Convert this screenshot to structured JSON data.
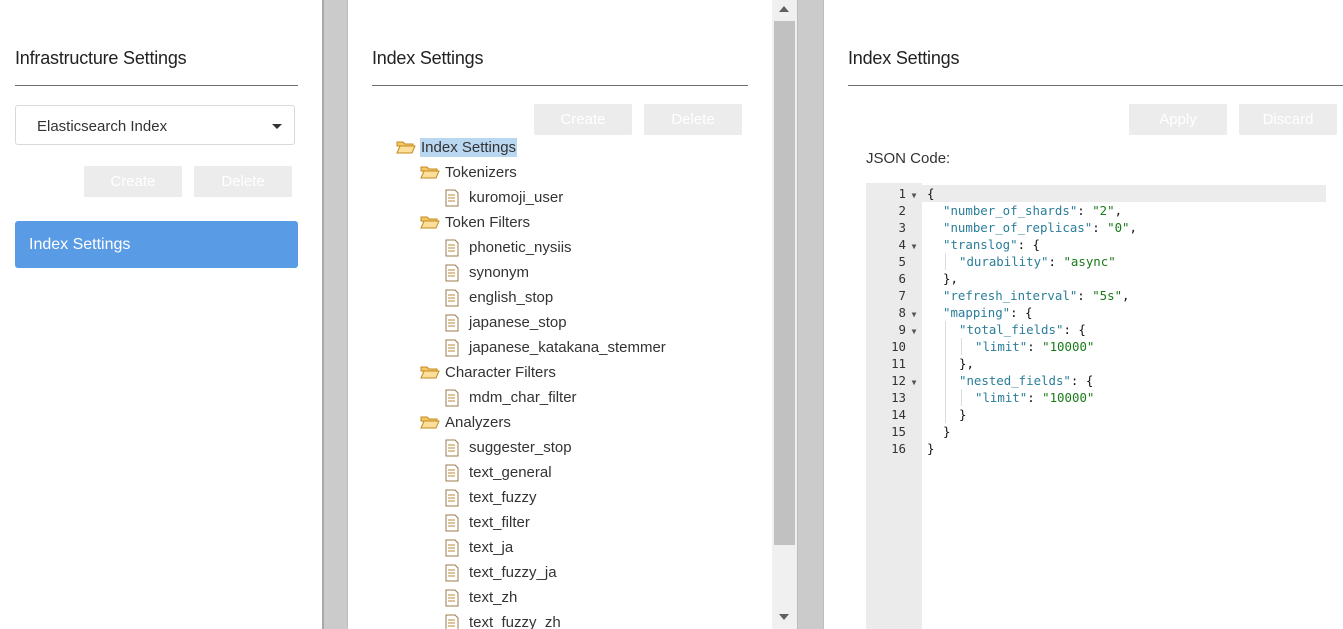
{
  "left_panel": {
    "title": "Infrastructure Settings",
    "dropdown_value": "Elasticsearch Index",
    "create_label": "Create",
    "delete_label": "Delete",
    "nav_items": [
      "Index Settings"
    ]
  },
  "middle_panel": {
    "title": "Index Settings",
    "create_label": "Create",
    "delete_label": "Delete",
    "tree": [
      {
        "label": "Index Settings",
        "type": "folder",
        "level": 0,
        "selected": true
      },
      {
        "label": "Tokenizers",
        "type": "folder",
        "level": 1
      },
      {
        "label": "kuromoji_user",
        "type": "file",
        "level": 2
      },
      {
        "label": "Token Filters",
        "type": "folder",
        "level": 1
      },
      {
        "label": "phonetic_nysiis",
        "type": "file",
        "level": 2
      },
      {
        "label": "synonym",
        "type": "file",
        "level": 2
      },
      {
        "label": "english_stop",
        "type": "file",
        "level": 2
      },
      {
        "label": "japanese_stop",
        "type": "file",
        "level": 2
      },
      {
        "label": "japanese_katakana_stemmer",
        "type": "file",
        "level": 2
      },
      {
        "label": "Character Filters",
        "type": "folder",
        "level": 1
      },
      {
        "label": "mdm_char_filter",
        "type": "file",
        "level": 2
      },
      {
        "label": "Analyzers",
        "type": "folder",
        "level": 1
      },
      {
        "label": "suggester_stop",
        "type": "file",
        "level": 2
      },
      {
        "label": "text_general",
        "type": "file",
        "level": 2
      },
      {
        "label": "text_fuzzy",
        "type": "file",
        "level": 2
      },
      {
        "label": "text_filter",
        "type": "file",
        "level": 2
      },
      {
        "label": "text_ja",
        "type": "file",
        "level": 2
      },
      {
        "label": "text_fuzzy_ja",
        "type": "file",
        "level": 2
      },
      {
        "label": "text_zh",
        "type": "file",
        "level": 2
      },
      {
        "label": "text_fuzzy_zh",
        "type": "file",
        "level": 2
      }
    ]
  },
  "right_panel": {
    "title": "Index Settings",
    "apply_label": "Apply",
    "discard_label": "Discard",
    "json_label": "JSON Code:",
    "code_lines": [
      {
        "n": "1",
        "fold": true,
        "indent": 0,
        "parts": [
          [
            "p",
            "{"
          ]
        ]
      },
      {
        "n": "2",
        "fold": false,
        "indent": 1,
        "parts": [
          [
            "k",
            "\"number_of_shards\""
          ],
          [
            "p",
            ": "
          ],
          [
            "s",
            "\"2\""
          ],
          [
            "p",
            ","
          ]
        ]
      },
      {
        "n": "3",
        "fold": false,
        "indent": 1,
        "parts": [
          [
            "k",
            "\"number_of_replicas\""
          ],
          [
            "p",
            ": "
          ],
          [
            "s",
            "\"0\""
          ],
          [
            "p",
            ","
          ]
        ]
      },
      {
        "n": "4",
        "fold": true,
        "indent": 1,
        "parts": [
          [
            "k",
            "\"translog\""
          ],
          [
            "p",
            ": {"
          ]
        ]
      },
      {
        "n": "5",
        "fold": false,
        "indent": 2,
        "parts": [
          [
            "k",
            "\"durability\""
          ],
          [
            "p",
            ": "
          ],
          [
            "s",
            "\"async\""
          ]
        ]
      },
      {
        "n": "6",
        "fold": false,
        "indent": 1,
        "parts": [
          [
            "p",
            "},"
          ]
        ]
      },
      {
        "n": "7",
        "fold": false,
        "indent": 1,
        "parts": [
          [
            "k",
            "\"refresh_interval\""
          ],
          [
            "p",
            ": "
          ],
          [
            "s",
            "\"5s\""
          ],
          [
            "p",
            ","
          ]
        ]
      },
      {
        "n": "8",
        "fold": true,
        "indent": 1,
        "parts": [
          [
            "k",
            "\"mapping\""
          ],
          [
            "p",
            ": {"
          ]
        ]
      },
      {
        "n": "9",
        "fold": true,
        "indent": 2,
        "parts": [
          [
            "k",
            "\"total_fields\""
          ],
          [
            "p",
            ": {"
          ]
        ]
      },
      {
        "n": "10",
        "fold": false,
        "indent": 3,
        "parts": [
          [
            "k",
            "\"limit\""
          ],
          [
            "p",
            ": "
          ],
          [
            "s",
            "\"10000\""
          ]
        ]
      },
      {
        "n": "11",
        "fold": false,
        "indent": 2,
        "parts": [
          [
            "p",
            "},"
          ]
        ]
      },
      {
        "n": "12",
        "fold": true,
        "indent": 2,
        "parts": [
          [
            "k",
            "\"nested_fields\""
          ],
          [
            "p",
            ": {"
          ]
        ]
      },
      {
        "n": "13",
        "fold": false,
        "indent": 3,
        "parts": [
          [
            "k",
            "\"limit\""
          ],
          [
            "p",
            ": "
          ],
          [
            "s",
            "\"10000\""
          ]
        ]
      },
      {
        "n": "14",
        "fold": false,
        "indent": 2,
        "parts": [
          [
            "p",
            "}"
          ]
        ]
      },
      {
        "n": "15",
        "fold": false,
        "indent": 1,
        "parts": [
          [
            "p",
            "}"
          ]
        ]
      },
      {
        "n": "16",
        "fold": false,
        "indent": 0,
        "parts": [
          [
            "p",
            "}"
          ]
        ]
      }
    ]
  },
  "colors": {
    "accent": "#5a9be6",
    "selection": "#b9d7f1",
    "json_key": "#2b7e9a",
    "json_string": "#1a7a1a"
  }
}
